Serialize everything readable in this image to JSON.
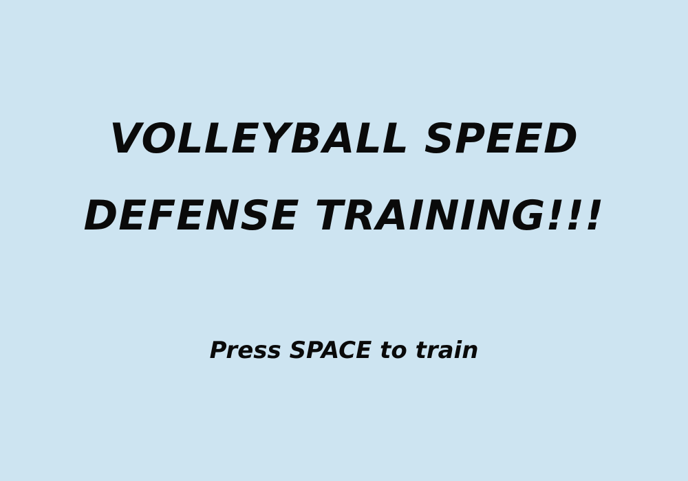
{
  "game": {
    "background_color": "#cde4f1",
    "text_color": "#0a0a0a",
    "title_lines": [
      "VOLLEYBALL SPEED",
      "DEFENSE TRAINING!!!"
    ],
    "prompt": "Press SPACE to train"
  }
}
